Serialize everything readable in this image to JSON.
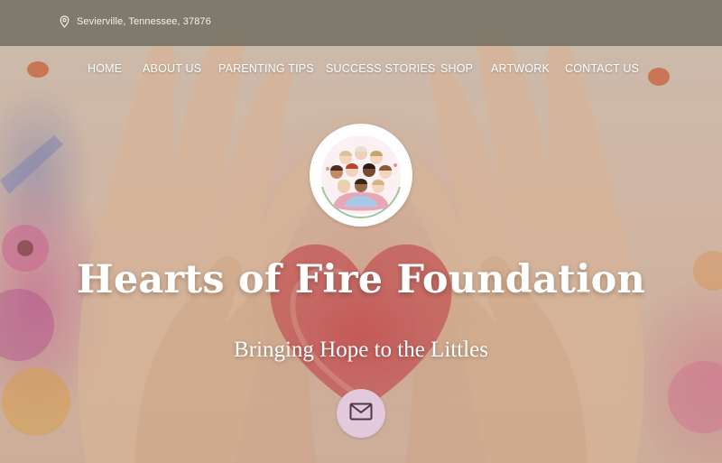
{
  "topbar": {
    "location_icon": "map-pin-icon",
    "location_text": "Sevierville, Tennessee, 37876"
  },
  "nav": {
    "items": [
      {
        "label": "HOME"
      },
      {
        "label": "ABOUT US"
      },
      {
        "label": "PARENTING TIPS"
      },
      {
        "label": "SUCCESS STORIES"
      },
      {
        "label": "SHOP"
      },
      {
        "label": "ARTWORK"
      },
      {
        "label": "CONTACT US"
      }
    ]
  },
  "hero": {
    "title": "Hearts of Fire Foundation",
    "subtitle": "Bringing Hope to the Littles",
    "cta_icon": "envelope-icon"
  },
  "colors": {
    "topbar_bg": "#69665c",
    "cta_bg": "#e2c9dc",
    "text": "#ffffff"
  }
}
